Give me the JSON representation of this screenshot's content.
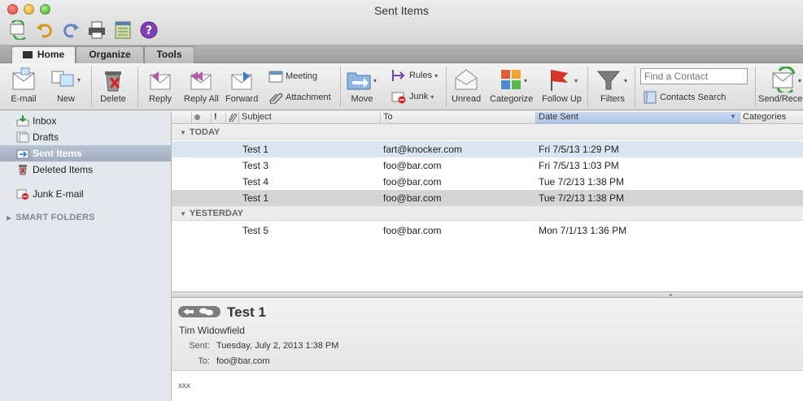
{
  "window": {
    "title": "Sent Items"
  },
  "quick_toolbar": [
    "sync-icon",
    "undo-icon",
    "redo-icon",
    "print-icon",
    "notes-icon",
    "help-icon"
  ],
  "tabs": [
    {
      "label": "Home",
      "active": true
    },
    {
      "label": "Organize",
      "active": false
    },
    {
      "label": "Tools",
      "active": false
    }
  ],
  "ribbon": {
    "email": "E-mail",
    "new": "New",
    "delete": "Delete",
    "reply": "Reply",
    "reply_all": "Reply All",
    "forward": "Forward",
    "meeting": "Meeting",
    "attachment": "Attachment",
    "move": "Move",
    "rules": "Rules",
    "junk": "Junk",
    "unread": "Unread",
    "categorize": "Categorize",
    "follow_up": "Follow Up",
    "filters": "Filters",
    "find_contact_placeholder": "Find a Contact",
    "contacts_search": "Contacts Search",
    "send_receive": "Send/Receive"
  },
  "sidebar": {
    "folders": [
      {
        "label": "Inbox",
        "icon": "inbox-icon"
      },
      {
        "label": "Drafts",
        "icon": "drafts-icon"
      },
      {
        "label": "Sent Items",
        "icon": "sent-icon",
        "selected": true
      },
      {
        "label": "Deleted Items",
        "icon": "trash-icon"
      },
      {
        "label": "Junk E-mail",
        "icon": "junk-icon"
      }
    ],
    "smart_folders": "SMART FOLDERS"
  },
  "list": {
    "columns": {
      "subject": "Subject",
      "to": "To",
      "date_sent": "Date Sent",
      "categories": "Categories"
    },
    "groups": [
      {
        "label": "TODAY",
        "rows": [
          {
            "subject": "Test 1",
            "to": "fart@knocker.com",
            "date": "Fri 7/5/13 1:29 PM"
          },
          {
            "subject": "Test 3",
            "to": "foo@bar.com",
            "date": "Fri 7/5/13 1:03 PM"
          },
          {
            "subject": "Test 4",
            "to": "foo@bar.com",
            "date": "Tue 7/2/13 1:38 PM"
          },
          {
            "subject": "Test 1",
            "to": "foo@bar.com",
            "date": "Tue 7/2/13 1:38 PM"
          }
        ]
      },
      {
        "label": "YESTERDAY",
        "rows": [
          {
            "subject": "Test 5",
            "to": "foo@bar.com",
            "date": "Mon 7/1/13 1:36 PM"
          }
        ]
      }
    ]
  },
  "reading_pane": {
    "subject": "Test 1",
    "from": "Tim Widowfield",
    "sent_label": "Sent:",
    "sent_value": "Tuesday, July 2, 2013 1:38 PM",
    "to_label": "To:",
    "to_value": "foo@bar.com",
    "body": "xxx"
  },
  "colors": {
    "selection": "#a2afc2",
    "row_highlight": "#dbe5f1",
    "date_sort_header": "#a9c3e6"
  }
}
